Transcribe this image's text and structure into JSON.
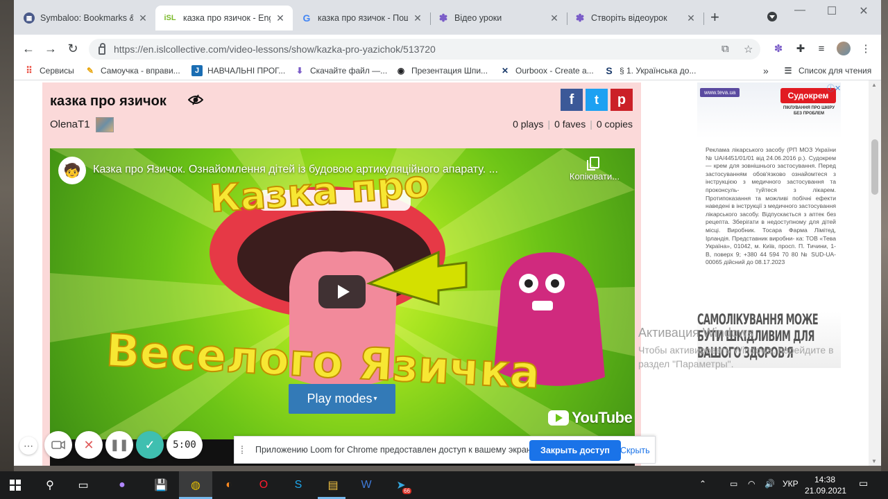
{
  "browser": {
    "tabs": [
      {
        "title": "Symbaloo: Bookmarks &",
        "icon": "symbaloo-icon",
        "active": false
      },
      {
        "title": "казка про язичок - Engli",
        "icon": "isl-icon",
        "active": true
      },
      {
        "title": "казка про язичок - Пош",
        "icon": "google-icon",
        "active": false
      },
      {
        "title": "Відео уроки",
        "icon": "flower-icon",
        "active": false
      },
      {
        "title": "Створіть відеоурок",
        "icon": "flower-icon",
        "active": false
      }
    ],
    "isl_fav_text": "iSL",
    "google_fav_text": "G",
    "new_tab": "+",
    "url": "https://en.islcollective.com/video-lessons/show/kazka-pro-yazichok/513720",
    "bookmarks": [
      {
        "label": "Сервисы",
        "icon": "apps-grid-icon"
      },
      {
        "label": "Самоучка - вправи...",
        "icon": "pencil-icon"
      },
      {
        "label": "НАВЧАЛЬНІ ПРОГ...",
        "icon": "j-app-icon"
      },
      {
        "label": "Скачайте файл —...",
        "icon": "download-icon"
      },
      {
        "label": "Презентация Шпи...",
        "icon": "globe-icon"
      },
      {
        "label": "Ourboox - Create a...",
        "icon": "x-logo-icon"
      },
      {
        "label": "§ 1. Українська до...",
        "icon": "s-logo-icon"
      }
    ],
    "bookmarks_more": "»",
    "reading_list": "Список для чтения"
  },
  "lesson": {
    "title": "казка про язичок",
    "author": "OlenaT1",
    "plays": "0 plays",
    "faves": "0 faves",
    "copies": "0 copies",
    "social": {
      "facebook": "f",
      "twitter": "t",
      "pinterest": "p"
    },
    "video": {
      "title": "Казка про Язичок. Ознайомлення дітей із будовою артикуляційного апарату. ...",
      "copy_label": "Копіювати...",
      "art_text_top": "Казка про",
      "art_text_bottom": "Веселого Язичка",
      "youtube_label": "YouTube",
      "play_modes": "Play modes"
    }
  },
  "ad": {
    "teva_label": "www.teva.ua",
    "brand": "Судокрем",
    "brand_sub": "ПІКЛУВАННЯ ПРО ШКІРУ БЕЗ ПРОБЛЕМ",
    "body": "Реклама лікарського засобу (РП МОЗ України № UA/4451/01/01 від 24.06.2016 р.). Судокрем — крем для зовнішнього застосування. Перед застосуванням обов'язково ознайомтеся з інструкцією з медичного застосування та проконсуль- туйтеся з лікарем. Протипоказання та можливі побічні ефекти наведені в інструкції з медичного застосування лікарського засобу. Відпускається з аптек без рецепта. Зберігати в недоступному для дітей місці. Виробник. Тосара Фарма Лімітед, Ірландія. Представник виробни- ка: ТОВ «Тева Україна», 01042, м. Київ, просп. П. Тичини, 1-В, поверх 9; +380 44 594 70 80 № SUD-UA-00065 дійсний до 08.17.2023",
    "slogan": "САМОЛІКУВАННЯ МОЖЕ БУТИ ШКІДЛИВИМ ДЛЯ ВАШОГО ЗДОРОВ'Я"
  },
  "windows_activation": {
    "title": "Активация Windows",
    "text": "Чтобы активировать Windows, перейдите в раздел \"Параметры\"."
  },
  "loom": {
    "timer": "5:00",
    "notice": "Приложению Loom for Chrome предоставлен доступ к вашему экрану.",
    "stop_label": "Закрыть доступ",
    "hide_label": "Скрыть"
  },
  "taskbar": {
    "lang": "УКР",
    "time": "14:38",
    "date": "21.09.2021",
    "telegram_badge": "66"
  },
  "colors": {
    "accent": "#1a73e8",
    "play_modes_bg": "#337ab7",
    "panel_bg": "#fbd9d9",
    "facebook": "#3b5998",
    "twitter": "#1da1f2",
    "pinterest": "#cb2027"
  }
}
